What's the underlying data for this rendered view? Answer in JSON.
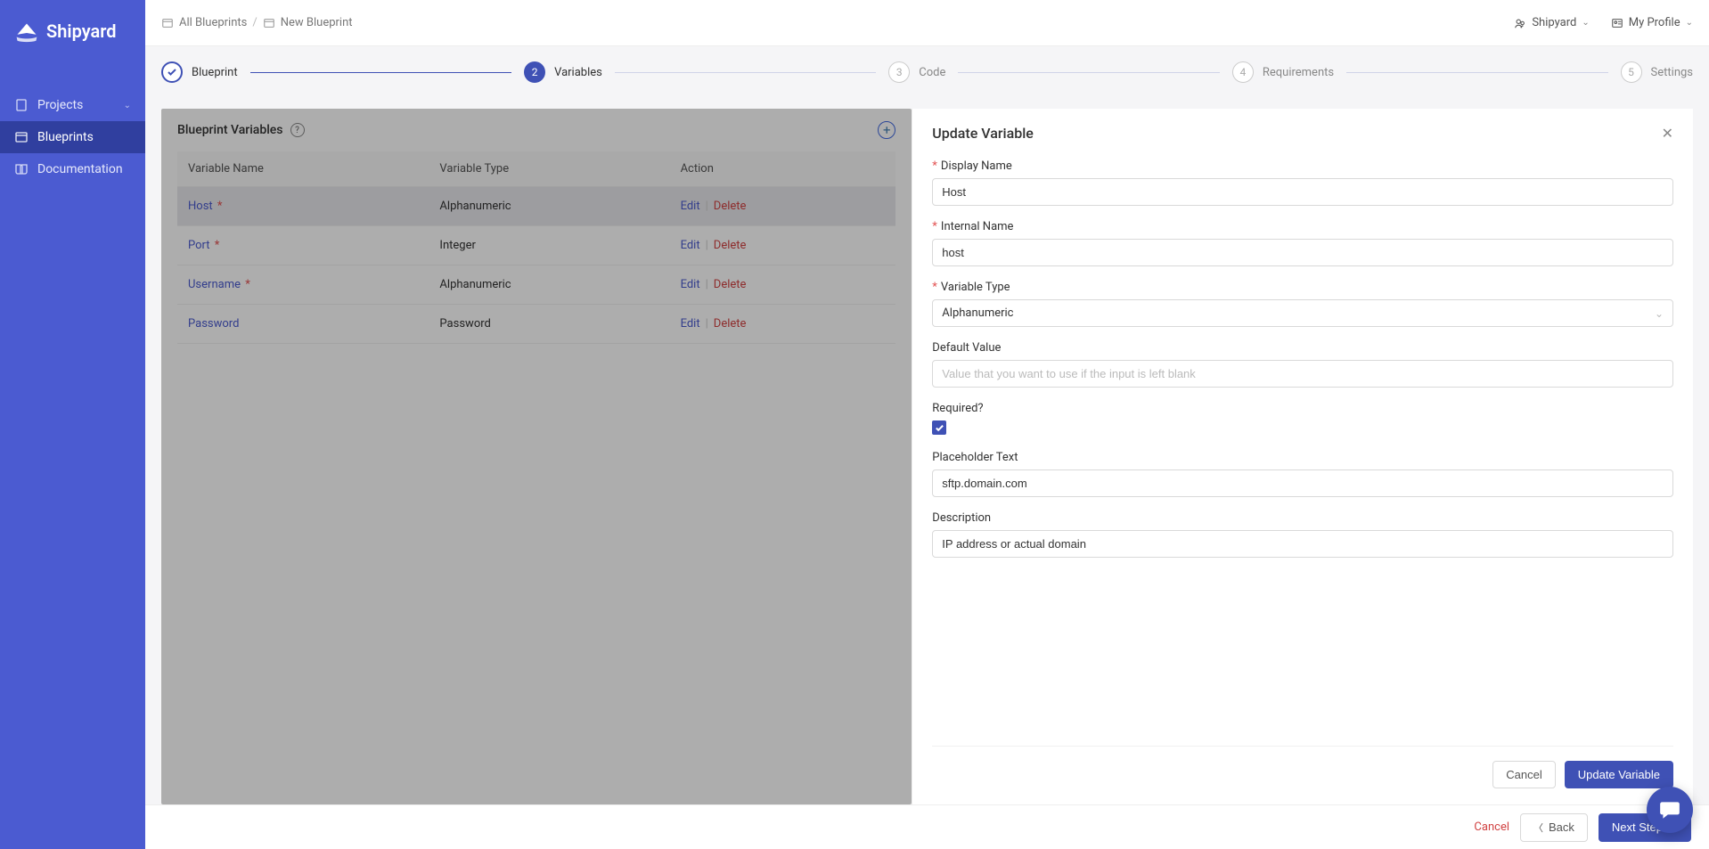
{
  "brand": {
    "name": "Shipyard"
  },
  "sidebar": {
    "items": [
      {
        "label": "Projects",
        "icon": "file-icon",
        "expandable": true
      },
      {
        "label": "Blueprints",
        "icon": "blueprint-icon"
      },
      {
        "label": "Documentation",
        "icon": "book-icon"
      }
    ],
    "active_index": 1
  },
  "topbar": {
    "breadcrumbs": [
      {
        "label": "All Blueprints"
      },
      {
        "label": "New Blueprint"
      }
    ],
    "org_menu": "Shipyard",
    "profile_menu": "My Profile"
  },
  "steps": [
    {
      "label": "Blueprint",
      "state": "done"
    },
    {
      "label": "Variables",
      "state": "current",
      "num": "2"
    },
    {
      "label": "Code",
      "state": "pending",
      "num": "3"
    },
    {
      "label": "Requirements",
      "state": "pending",
      "num": "4"
    },
    {
      "label": "Settings",
      "state": "pending",
      "num": "5"
    }
  ],
  "var_panel": {
    "title": "Blueprint Variables",
    "columns": {
      "name": "Variable Name",
      "type": "Variable Type",
      "action": "Action"
    },
    "rows": [
      {
        "name": "Host",
        "required": true,
        "type": "Alphanumeric",
        "selected": true
      },
      {
        "name": "Port",
        "required": true,
        "type": "Integer"
      },
      {
        "name": "Username",
        "required": true,
        "type": "Alphanumeric"
      },
      {
        "name": "Password",
        "required": false,
        "type": "Password"
      }
    ],
    "actions": {
      "edit": "Edit",
      "delete": "Delete"
    }
  },
  "form": {
    "title": "Update Variable",
    "labels": {
      "display_name": "Display Name",
      "internal_name": "Internal Name",
      "variable_type": "Variable Type",
      "default_value": "Default Value",
      "required": "Required?",
      "placeholder_text": "Placeholder Text",
      "description": "Description"
    },
    "values": {
      "display_name": "Host",
      "internal_name": "host",
      "variable_type": "Alphanumeric",
      "default_value": "",
      "default_value_placeholder": "Value that you want to use if the input is left blank",
      "required": true,
      "placeholder_text": "sftp.domain.com",
      "description": "IP address or actual domain"
    },
    "buttons": {
      "cancel": "Cancel",
      "submit": "Update Variable"
    }
  },
  "bottom": {
    "cancel": "Cancel",
    "back": "Back",
    "next": "Next Step"
  }
}
